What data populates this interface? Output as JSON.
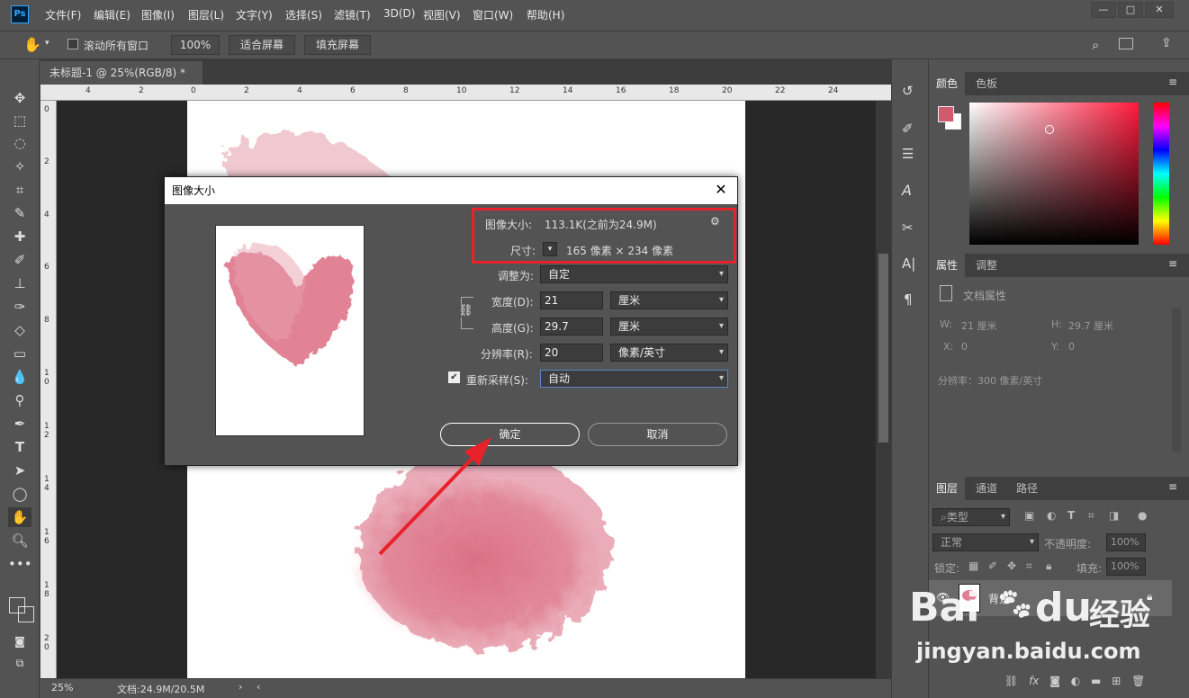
{
  "app": {
    "logo": "Ps"
  },
  "menu": [
    "文件(F)",
    "编辑(E)",
    "图像(I)",
    "图层(L)",
    "文字(Y)",
    "选择(S)",
    "滤镜(T)",
    "3D(D)",
    "视图(V)",
    "窗口(W)",
    "帮助(H)"
  ],
  "options": {
    "scroll_all": "滚动所有窗口",
    "zoom": "100%",
    "fit_screen": "适合屏幕",
    "fill_screen": "填充屏幕"
  },
  "doc": {
    "tab_title": "未标题-1 @ 25%(RGB/8) *",
    "zoom": "25%",
    "doc_size": "文档:24.9M/20.5M"
  },
  "ruler": {
    "h_ticks": [
      "4",
      "2",
      "0",
      "2",
      "4",
      "6",
      "8",
      "10",
      "12",
      "14",
      "16",
      "18",
      "20",
      "22",
      "24"
    ],
    "v_ticks": [
      "0",
      "2",
      "4",
      "6",
      "8",
      "1\n0",
      "1\n2",
      "1\n4",
      "1\n6",
      "1\n8",
      "2\n0"
    ]
  },
  "color_panel": {
    "tab_color": "颜色",
    "tab_swatches": "色板",
    "fg_color": "#d05a6e",
    "bg_color": "#ffffff"
  },
  "props_panel": {
    "tab_props": "属性",
    "tab_adjust": "调整",
    "doc_props": "文档属性",
    "w_label": "W:",
    "w_value": "21 厘米",
    "h_label": "H:",
    "h_value": "29.7 厘米",
    "x_label": "X:",
    "x_value": "0",
    "y_label": "Y:",
    "y_value": "0",
    "resolution": "分辨率：300 像素/英寸"
  },
  "layers_panel": {
    "tab_layers": "图层",
    "tab_channels": "通道",
    "tab_paths": "路径",
    "filter": "类型",
    "blend": "正常",
    "opacity_label": "不透明度:",
    "opacity_value": "100%",
    "lock_label": "锁定:",
    "fill_label": "填充:",
    "fill_value": "100%",
    "layer_name": "背景"
  },
  "dialog": {
    "title": "图像大小",
    "image_size_label": "图像大小:",
    "image_size_value": "113.1K(之前为24.9M)",
    "dimensions_label": "尺寸:",
    "dimensions_value": "165 像素  ×  234 像素",
    "fit_to_label": "调整为:",
    "fit_to_value": "自定",
    "width_label": "宽度(D):",
    "width_value": "21",
    "width_unit": "厘米",
    "height_label": "高度(G):",
    "height_value": "29.7",
    "height_unit": "厘米",
    "resolution_label": "分辨率(R):",
    "resolution_value": "20",
    "resolution_unit": "像素/英寸",
    "resample_label": "重新采样(S):",
    "resample_value": "自动",
    "ok": "确定",
    "cancel": "取消"
  },
  "watermark": {
    "brand": "Bai",
    "brand2": "du",
    "sub": "经验",
    "url": "jingyan.baidu.com"
  },
  "colors": {
    "accent_red": "#e8222b",
    "heart": "#d9647a"
  }
}
